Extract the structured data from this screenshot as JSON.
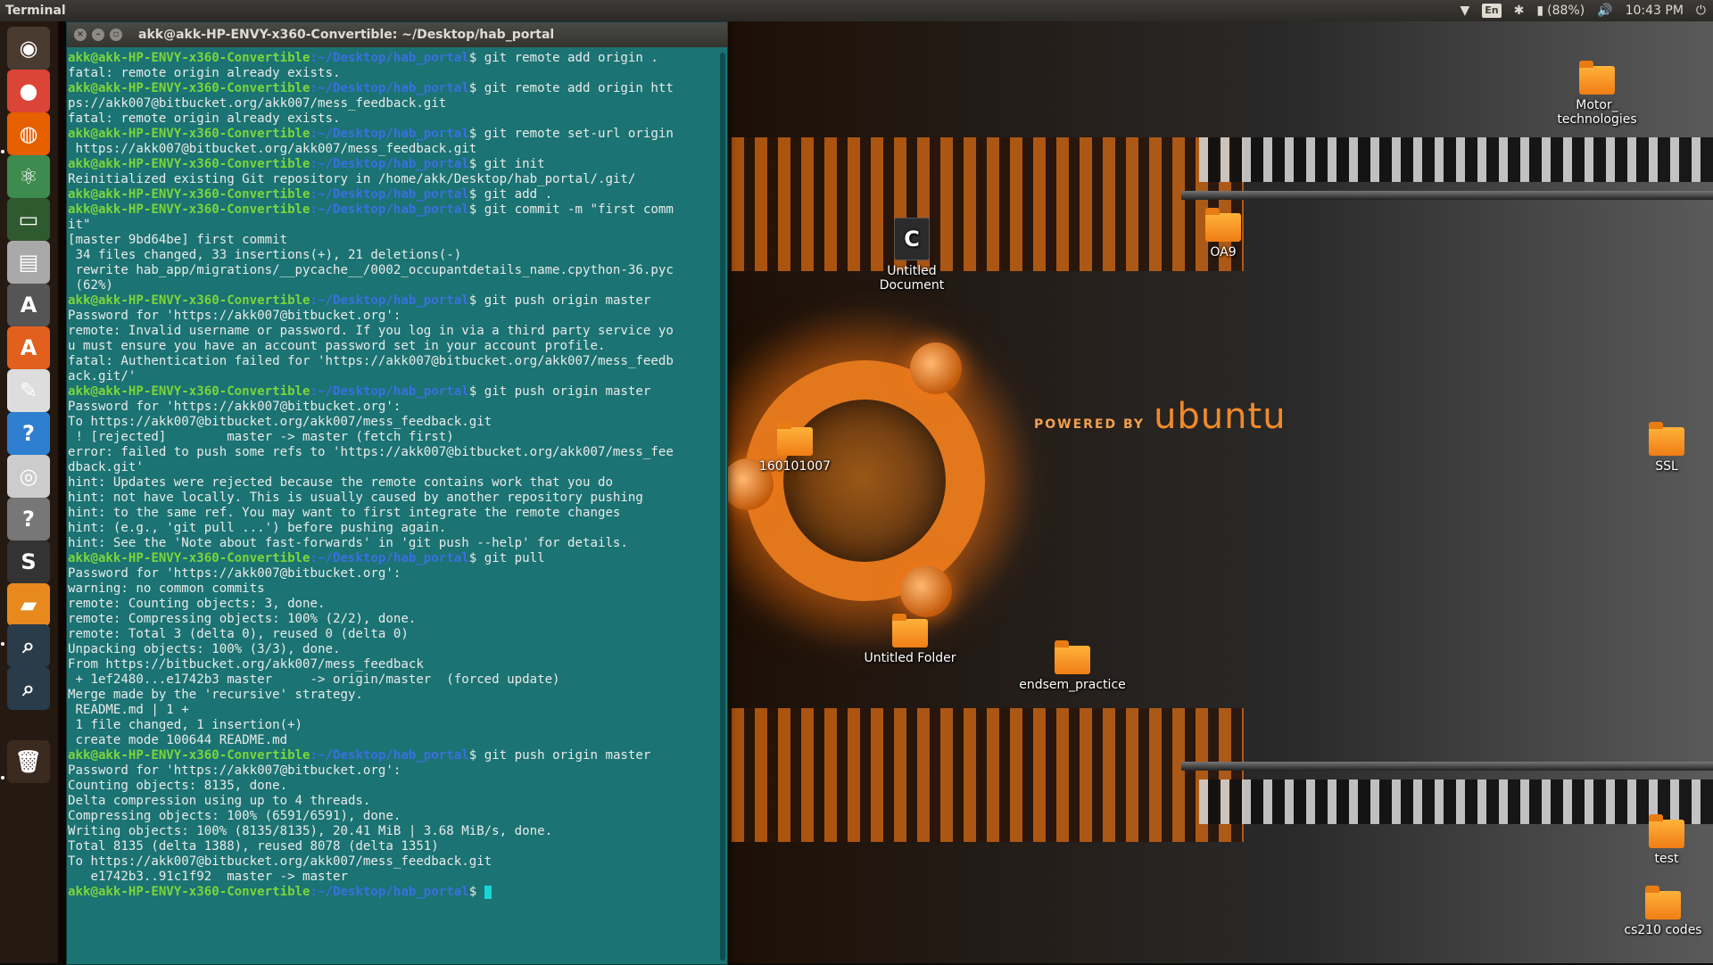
{
  "top_panel": {
    "app_title": "Terminal",
    "keyboard_layout": "En",
    "battery": "(88%)",
    "clock": "10:43 PM"
  },
  "launcher": {
    "items": [
      {
        "name": "ubuntu-dash-icon",
        "glyph": "◉",
        "color": "#4a3b30"
      },
      {
        "name": "chrome-icon",
        "glyph": "●",
        "color": "#db4437"
      },
      {
        "name": "firefox-icon",
        "glyph": "◍",
        "color": "#e66000"
      },
      {
        "name": "atom-icon",
        "glyph": "⚛",
        "color": "#3d8b4f"
      },
      {
        "name": "system-monitor-icon",
        "glyph": "▭",
        "color": "#2f5a2f"
      },
      {
        "name": "files-icon",
        "glyph": "▤",
        "color": "#a9a9a9"
      },
      {
        "name": "software-updater-icon",
        "glyph": "A",
        "color": "#555"
      },
      {
        "name": "ubuntu-software-icon",
        "glyph": "A",
        "color": "#e2601d"
      },
      {
        "name": "evince-icon",
        "glyph": "✎",
        "color": "#dddddd"
      },
      {
        "name": "help-icon",
        "glyph": "?",
        "color": "#2f7fd0"
      },
      {
        "name": "webcam-icon",
        "glyph": "◎",
        "color": "#cccccc"
      },
      {
        "name": "unknown-app-icon",
        "glyph": "?",
        "color": "#777"
      },
      {
        "name": "sublime-text-icon",
        "glyph": "S",
        "color": "#333"
      },
      {
        "name": "file-manager-icon",
        "glyph": "▰",
        "color": "#e8891e"
      },
      {
        "name": "screenshot-icon",
        "glyph": "⌕",
        "color": "#2a3b4a"
      },
      {
        "name": "screenshot-icon-2",
        "glyph": "⌕",
        "color": "#2a3b4a"
      },
      {
        "name": "trash-icon",
        "glyph": "🗑",
        "color": "#3a2a20"
      }
    ]
  },
  "wallpaper": {
    "powered_by": "POWERED BY",
    "brand": "ubuntu"
  },
  "desktop_icons": [
    {
      "label": "Motor_ technologies",
      "kind": "folder"
    },
    {
      "label": "Untitled Document",
      "kind": "doc",
      "glyph": "C"
    },
    {
      "label": "OA9",
      "kind": "folder"
    },
    {
      "label": "160101007",
      "kind": "folder"
    },
    {
      "label": "SSL",
      "kind": "folder"
    },
    {
      "label": "Untitled Folder",
      "kind": "folder"
    },
    {
      "label": "endsem_practice",
      "kind": "folder"
    },
    {
      "label": "test",
      "kind": "folder"
    },
    {
      "label": "cs210 codes",
      "kind": "folder"
    }
  ],
  "terminal": {
    "title": "akk@akk-HP-ENVY-x360-Convertible: ~/Desktop/hab_portal",
    "user_host": "akk@akk-HP-ENVY-x360-Convertible",
    "path": ":~/Desktop/hab_portal",
    "lines": [
      {
        "p": true,
        "t": "$ git remote add origin ."
      },
      {
        "p": false,
        "t": "fatal: remote origin already exists."
      },
      {
        "p": true,
        "t": "$ git remote add origin htt"
      },
      {
        "p": false,
        "t": "ps://akk007@bitbucket.org/akk007/mess_feedback.git"
      },
      {
        "p": false,
        "t": "fatal: remote origin already exists."
      },
      {
        "p": true,
        "t": "$ git remote set-url origin"
      },
      {
        "p": false,
        "t": " https://akk007@bitbucket.org/akk007/mess_feedback.git"
      },
      {
        "p": true,
        "t": "$ git init"
      },
      {
        "p": false,
        "t": "Reinitialized existing Git repository in /home/akk/Desktop/hab_portal/.git/"
      },
      {
        "p": true,
        "t": "$ git add ."
      },
      {
        "p": true,
        "t": "$ git commit -m \"first comm"
      },
      {
        "p": false,
        "t": "it\""
      },
      {
        "p": false,
        "t": "[master 9bd64be] first commit"
      },
      {
        "p": false,
        "t": " 34 files changed, 33 insertions(+), 21 deletions(-)"
      },
      {
        "p": false,
        "t": " rewrite hab_app/migrations/__pycache__/0002_occupantdetails_name.cpython-36.pyc"
      },
      {
        "p": false,
        "t": " (62%)"
      },
      {
        "p": true,
        "t": "$ git push origin master"
      },
      {
        "p": false,
        "t": "Password for 'https://akk007@bitbucket.org':"
      },
      {
        "p": false,
        "t": "remote: Invalid username or password. If you log in via a third party service yo"
      },
      {
        "p": false,
        "t": "u must ensure you have an account password set in your account profile."
      },
      {
        "p": false,
        "t": "fatal: Authentication failed for 'https://akk007@bitbucket.org/akk007/mess_feedb"
      },
      {
        "p": false,
        "t": "ack.git/'"
      },
      {
        "p": true,
        "t": "$ git push origin master"
      },
      {
        "p": false,
        "t": "Password for 'https://akk007@bitbucket.org':"
      },
      {
        "p": false,
        "t": "To https://akk007@bitbucket.org/akk007/mess_feedback.git"
      },
      {
        "p": false,
        "t": " ! [rejected]        master -> master (fetch first)"
      },
      {
        "p": false,
        "t": "error: failed to push some refs to 'https://akk007@bitbucket.org/akk007/mess_fee"
      },
      {
        "p": false,
        "t": "dback.git'"
      },
      {
        "p": false,
        "t": "hint: Updates were rejected because the remote contains work that you do"
      },
      {
        "p": false,
        "t": "hint: not have locally. This is usually caused by another repository pushing"
      },
      {
        "p": false,
        "t": "hint: to the same ref. You may want to first integrate the remote changes"
      },
      {
        "p": false,
        "t": "hint: (e.g., 'git pull ...') before pushing again."
      },
      {
        "p": false,
        "t": "hint: See the 'Note about fast-forwards' in 'git push --help' for details."
      },
      {
        "p": true,
        "t": "$ git pull"
      },
      {
        "p": false,
        "t": "Password for 'https://akk007@bitbucket.org':"
      },
      {
        "p": false,
        "t": "warning: no common commits"
      },
      {
        "p": false,
        "t": "remote: Counting objects: 3, done."
      },
      {
        "p": false,
        "t": "remote: Compressing objects: 100% (2/2), done."
      },
      {
        "p": false,
        "t": "remote: Total 3 (delta 0), reused 0 (delta 0)"
      },
      {
        "p": false,
        "t": "Unpacking objects: 100% (3/3), done."
      },
      {
        "p": false,
        "t": "From https://bitbucket.org/akk007/mess_feedback"
      },
      {
        "p": false,
        "t": " + 1ef2480...e1742b3 master     -> origin/master  (forced update)"
      },
      {
        "p": false,
        "t": "Merge made by the 'recursive' strategy."
      },
      {
        "p": false,
        "t": " README.md | 1 +"
      },
      {
        "p": false,
        "t": " 1 file changed, 1 insertion(+)"
      },
      {
        "p": false,
        "t": " create mode 100644 README.md"
      },
      {
        "p": true,
        "t": "$ git push origin master"
      },
      {
        "p": false,
        "t": "Password for 'https://akk007@bitbucket.org':"
      },
      {
        "p": false,
        "t": "Counting objects: 8135, done."
      },
      {
        "p": false,
        "t": "Delta compression using up to 4 threads."
      },
      {
        "p": false,
        "t": "Compressing objects: 100% (6591/6591), done."
      },
      {
        "p": false,
        "t": "Writing objects: 100% (8135/8135), 20.41 MiB | 3.68 MiB/s, done."
      },
      {
        "p": false,
        "t": "Total 8135 (delta 1388), reused 8078 (delta 1351)"
      },
      {
        "p": false,
        "t": "To https://akk007@bitbucket.org/akk007/mess_feedback.git"
      },
      {
        "p": false,
        "t": "   e1742b3..91c1f92  master -> master"
      },
      {
        "p": true,
        "t": "$ "
      }
    ]
  }
}
